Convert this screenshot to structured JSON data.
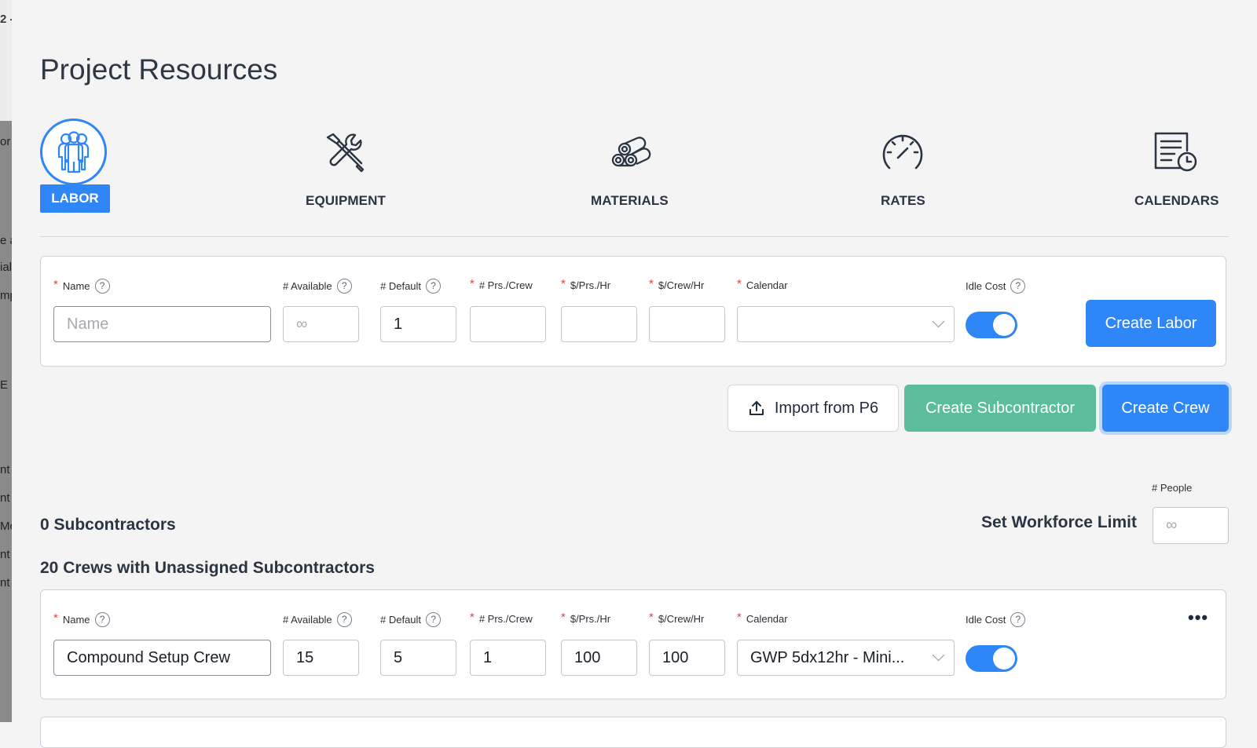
{
  "page": {
    "title": "Project Resources"
  },
  "left_fragments": [
    "2 -",
    "or",
    "e a",
    "ial",
    "mp",
    "E",
    "nt",
    "nt",
    "Mc",
    "nt",
    "nt"
  ],
  "tabs": [
    {
      "label": "LABOR",
      "icon": "people-group-icon",
      "active": true
    },
    {
      "label": "EQUIPMENT",
      "icon": "tools-icon"
    },
    {
      "label": "MATERIALS",
      "icon": "materials-pipes-icon"
    },
    {
      "label": "RATES",
      "icon": "speedometer-icon"
    },
    {
      "label": "CALENDARS",
      "icon": "document-clock-icon"
    }
  ],
  "form_labels": {
    "name": "Name",
    "available": "# Available",
    "default": "# Default",
    "prs_crew": "# Prs./Crew",
    "prs_hr": "$/Prs./Hr",
    "crew_hr": "$/Crew/Hr",
    "calendar": "Calendar",
    "idle_cost": "Idle Cost",
    "required_mark": "*",
    "help": "?"
  },
  "new_labor": {
    "name_placeholder": "Name",
    "available_placeholder": "∞",
    "default_value": "1",
    "prs_crew": "",
    "prs_hr": "",
    "crew_hr": "",
    "calendar": "",
    "idle_cost_on": true,
    "create_button": "Create Labor"
  },
  "actions": {
    "import": "Import from P6",
    "create_subcontractor": "Create Subcontractor",
    "create_crew": "Create Crew"
  },
  "workforce": {
    "people_label": "# People",
    "set_limit_label": "Set Workforce Limit",
    "limit_placeholder": "∞"
  },
  "sections": {
    "subcontractors": "0 Subcontractors",
    "unassigned": "20 Crews with Unassigned Subcontractors"
  },
  "crews": [
    {
      "name": "Compound Setup Crew",
      "available": "15",
      "default": "5",
      "prs_crew": "1",
      "prs_hr": "100",
      "crew_hr": "100",
      "calendar": "GWP 5dx12hr - Mini...",
      "idle_cost_on": true,
      "menu": "•••"
    }
  ],
  "colors": {
    "accent": "#2f86f6",
    "green": "#5bbd9c",
    "required": "#e8403f"
  }
}
